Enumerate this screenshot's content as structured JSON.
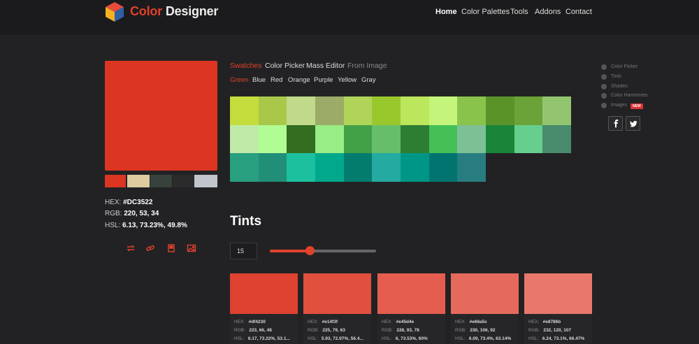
{
  "header": {
    "brand_part1": "Color",
    "brand_part2": "Designer",
    "nav": [
      "Home",
      "Color Palettes",
      "Tools",
      "Addons",
      "Contact"
    ]
  },
  "color": {
    "hex_label": "HEX:",
    "hex": "#DC3522",
    "rgb_label": "RGB:",
    "rgb": "220, 53, 34",
    "hsl_label": "HSL:",
    "hsl": "6.13, 73.23%, 49.8%",
    "main": "#dc3522",
    "palette": [
      "#dc3522",
      "#dccca0",
      "#37423d",
      "#2b2b2b",
      "#c0c6cc"
    ]
  },
  "actions": [
    "shuffle-icon",
    "link-icon",
    "bookmark-icon",
    "image-icon"
  ],
  "tabs": [
    "Swatches",
    "Color Picker",
    "Mass Editor",
    "From Image"
  ],
  "subtabs": [
    "Green",
    "Blue",
    "Red",
    "Orange",
    "Purple",
    "Yellow",
    "Gray"
  ],
  "swatches": [
    "#c4dc3c",
    "#a9c849",
    "#c0d98a",
    "#9aac68",
    "#b0d45a",
    "#98c82c",
    "#bce65c",
    "#c5f47a",
    "#8ac34c",
    "#5a9429",
    "#6ba338",
    "#93c571",
    "#c0eaa8",
    "#b2fd93",
    "#336d1f",
    "#98ed84",
    "#42a146",
    "#66be6a",
    "#2d7d35",
    "#44c057",
    "#7dc095",
    "#188539",
    "#66cf8e",
    "#478b6c",
    "#289f7f",
    "#218f77",
    "#1cc09f",
    "#02a88c",
    "#037c6e",
    "#24aaa0",
    "#009686",
    "#027470",
    "#287d80"
  ],
  "sidebar": {
    "items": [
      "Color Picker",
      "Tints",
      "Shades",
      "Color Harmonies",
      "Images"
    ],
    "new_badge": "NEW"
  },
  "social": [
    "facebook-icon",
    "twitter-icon"
  ],
  "tints": {
    "title": "Tints",
    "count": "15",
    "slider_value": 0.37,
    "cards": [
      {
        "color": "#df4230",
        "hex": "#df4230",
        "rgb": "223, 66, 48",
        "hsl": "6.17, 73.22%, 53.1..."
      },
      {
        "color": "#e14f3f",
        "hex": "#e14f3f",
        "rgb": "225, 79, 63",
        "hsl": "5.93, 72.97%, 56.4..."
      },
      {
        "color": "#e45d4e",
        "hex": "#e45d4e",
        "rgb": "228, 93, 78",
        "hsl": "6, 73.53%, 60%"
      },
      {
        "color": "#e66a5c",
        "hex": "#e66a5c",
        "rgb": "230, 106, 92",
        "hsl": "6.09, 73.4%, 63.14%"
      },
      {
        "color": "#e8786b",
        "hex": "#e8786b",
        "rgb": "232, 120, 107",
        "hsl": "6.24, 73.1%, 66.47%"
      }
    ],
    "labels": {
      "hex": "HEX:",
      "rgb": "RGB:",
      "hsl": "HSL:"
    }
  }
}
